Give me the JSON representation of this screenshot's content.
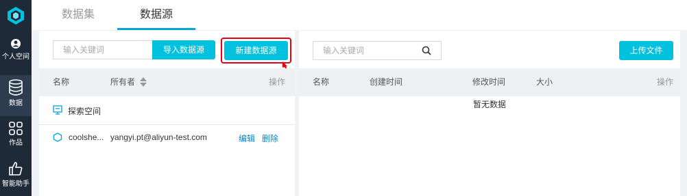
{
  "sidebar": {
    "items": [
      {
        "label": "个人空间",
        "icon": "user-icon"
      },
      {
        "label": "数据",
        "icon": "database-icon"
      },
      {
        "label": "作品",
        "icon": "grid-icon"
      },
      {
        "label": "智能助手",
        "icon": "thumbs-up-icon"
      }
    ]
  },
  "tabs": [
    {
      "label": "数据集"
    },
    {
      "label": "数据源",
      "active": true
    }
  ],
  "left": {
    "search_placeholder": "输入关键词",
    "import_label": "导入数据源",
    "new_label": "新建数据源",
    "columns": {
      "name": "名称",
      "owner": "所有者",
      "ops": "操作"
    },
    "group_label": "探索空间",
    "rows": [
      {
        "name": "coolshe...",
        "owner": "yangyi.pt@aliyun-test.com",
        "edit": "编辑",
        "delete": "删除"
      }
    ]
  },
  "right": {
    "search_placeholder": "输入关键词",
    "upload_label": "上传文件",
    "columns": {
      "name": "名称",
      "created": "创建时间",
      "modified": "修改时间",
      "size": "大小",
      "ops": "操作"
    },
    "empty_text": "暂无数据"
  },
  "colors": {
    "accent": "#00c1de",
    "highlight": "#e60012",
    "link": "#0088cc",
    "rail": "#1e2a38"
  }
}
